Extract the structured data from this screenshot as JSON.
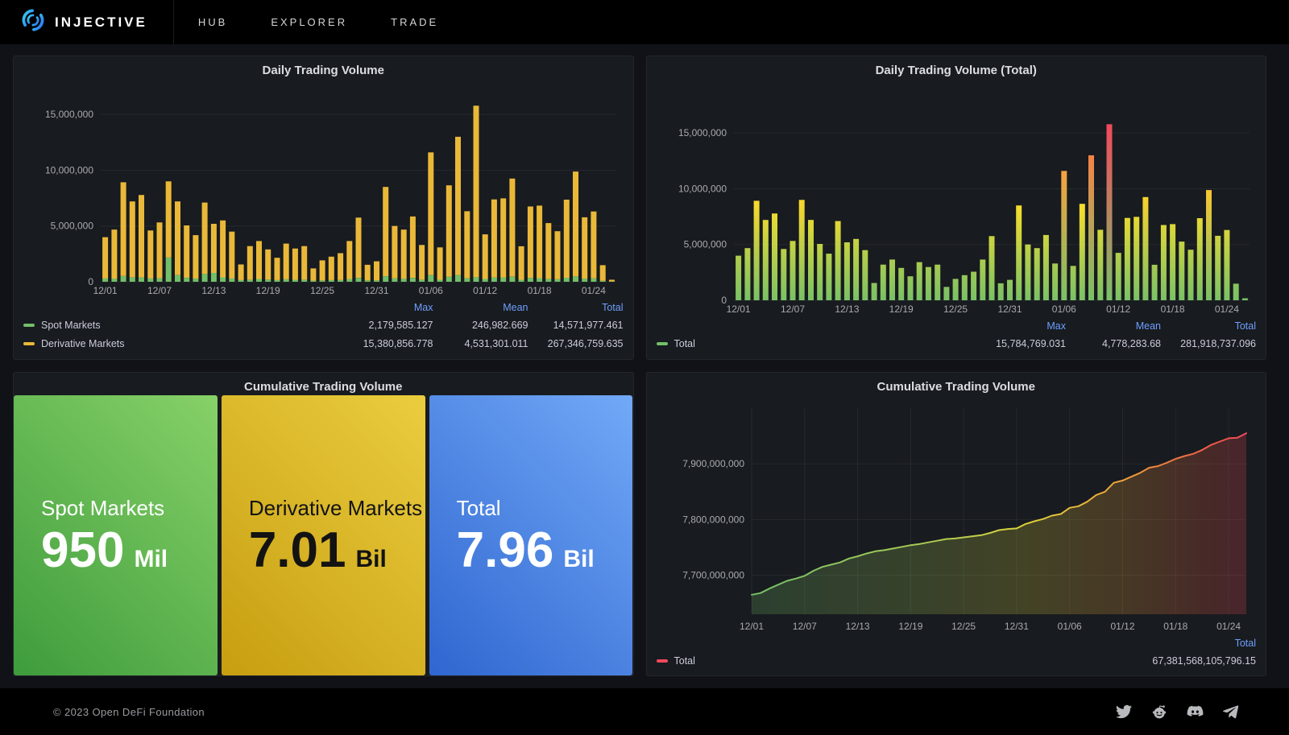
{
  "nav": {
    "brand": "INJECTIVE",
    "items": [
      {
        "label": "HUB"
      },
      {
        "label": "EXPLORER"
      },
      {
        "label": "TRADE"
      }
    ]
  },
  "footer": {
    "copyright": "© 2023 Open DeFi Foundation",
    "icons": [
      "twitter-icon",
      "reddit-icon",
      "discord-icon",
      "telegram-icon"
    ]
  },
  "colors": {
    "spot_green": "#73BF69",
    "derivative_yellow": "#EAB839",
    "total_red": "#F2495C",
    "legend_header_blue": "#6E9FFF",
    "panel_bg": "#181b1f",
    "page_bg": "#111217"
  },
  "chart_data": [
    {
      "type": "bar",
      "stacked": true,
      "title": "Daily Trading Volume",
      "tick_every": 6,
      "yticks": [
        0,
        5000000,
        10000000,
        15000000
      ],
      "ylim": [
        0,
        16600000
      ],
      "categories": [
        "12/01",
        "12/02",
        "12/03",
        "12/04",
        "12/05",
        "12/06",
        "12/07",
        "12/08",
        "12/09",
        "12/10",
        "12/11",
        "12/12",
        "12/13",
        "12/14",
        "12/15",
        "12/16",
        "12/17",
        "12/18",
        "12/19",
        "12/20",
        "12/21",
        "12/22",
        "12/23",
        "12/24",
        "12/25",
        "12/26",
        "12/27",
        "12/28",
        "12/29",
        "12/30",
        "12/31",
        "01/01",
        "01/02",
        "01/03",
        "01/04",
        "01/05",
        "01/06",
        "01/07",
        "01/08",
        "01/09",
        "01/10",
        "01/11",
        "01/12",
        "01/13",
        "01/14",
        "01/15",
        "01/16",
        "01/17",
        "01/18",
        "01/19",
        "01/20",
        "01/21",
        "01/22",
        "01/23",
        "01/24",
        "01/25",
        "01/26"
      ],
      "series": [
        {
          "name": "Spot Markets",
          "color": "#73BF69",
          "values": [
            300000,
            280000,
            520000,
            400000,
            380000,
            300000,
            320000,
            2179585,
            600000,
            350000,
            280000,
            700000,
            800000,
            400000,
            300000,
            150000,
            200000,
            250000,
            200000,
            150000,
            220000,
            180000,
            200000,
            100000,
            120000,
            150000,
            160000,
            250000,
            350000,
            120000,
            130000,
            500000,
            300000,
            280000,
            350000,
            200000,
            600000,
            180000,
            450000,
            600000,
            320000,
            403912,
            250000,
            380000,
            380000,
            450000,
            180000,
            350000,
            330000,
            260000,
            230000,
            360000,
            480000,
            280000,
            300000,
            90000,
            30000
          ]
        },
        {
          "name": "Derivative Markets",
          "color": "#EAB839",
          "values": [
            3700000,
            4400000,
            8400000,
            6800000,
            7400000,
            4300000,
            5000000,
            6820000,
            6600000,
            4700000,
            3900000,
            6400000,
            4400000,
            5100000,
            4200000,
            1400000,
            3000000,
            3400000,
            2700000,
            2000000,
            3200000,
            2800000,
            3000000,
            1100000,
            1800000,
            2100000,
            2400000,
            3400000,
            5400000,
            1400000,
            1700000,
            8000000,
            4700000,
            4400000,
            5500000,
            3100000,
            11000000,
            2900000,
            8200000,
            12400000,
            6000000,
            15380857,
            4000000,
            7000000,
            7100000,
            8800000,
            3000000,
            6400000,
            6500000,
            5000000,
            4300000,
            7000000,
            9400000,
            5500000,
            6000000,
            1400000,
            150000
          ]
        }
      ],
      "legend": {
        "columns": [
          "Max",
          "Mean",
          "Total"
        ],
        "rows": [
          {
            "label": "Spot Markets",
            "color": "#73BF69",
            "values": [
              "2,179,585.127",
              "246,982.669",
              "14,571,977.461"
            ]
          },
          {
            "label": "Derivative Markets",
            "color": "#EAB839",
            "values": [
              "15,380,856.778",
              "4,531,301.011",
              "267,346,759.635"
            ]
          }
        ]
      }
    },
    {
      "type": "bar",
      "stacked": false,
      "color_mode": "scheme-green-yellow-red",
      "title": "Daily Trading Volume (Total)",
      "tick_every": 6,
      "yticks": [
        0,
        5000000,
        10000000,
        15000000
      ],
      "ylim": [
        0,
        16600000
      ],
      "categories": [
        "12/01",
        "12/02",
        "12/03",
        "12/04",
        "12/05",
        "12/06",
        "12/07",
        "12/08",
        "12/09",
        "12/10",
        "12/11",
        "12/12",
        "12/13",
        "12/14",
        "12/15",
        "12/16",
        "12/17",
        "12/18",
        "12/19",
        "12/20",
        "12/21",
        "12/22",
        "12/23",
        "12/24",
        "12/25",
        "12/26",
        "12/27",
        "12/28",
        "12/29",
        "12/30",
        "12/31",
        "01/01",
        "01/02",
        "01/03",
        "01/04",
        "01/05",
        "01/06",
        "01/07",
        "01/08",
        "01/09",
        "01/10",
        "01/11",
        "01/12",
        "01/13",
        "01/14",
        "01/15",
        "01/16",
        "01/17",
        "01/18",
        "01/19",
        "01/20",
        "01/21",
        "01/22",
        "01/23",
        "01/24",
        "01/25",
        "01/26"
      ],
      "series": [
        {
          "name": "Total",
          "values": [
            4000000,
            4680000,
            8920000,
            7200000,
            7780000,
            4600000,
            5320000,
            8999585,
            7200000,
            5050000,
            4180000,
            7100000,
            5200000,
            5500000,
            4500000,
            1550000,
            3200000,
            3650000,
            2900000,
            2150000,
            3420000,
            2980000,
            3200000,
            1200000,
            1920000,
            2250000,
            2560000,
            3650000,
            5750000,
            1520000,
            1830000,
            8500000,
            5000000,
            4680000,
            5850000,
            3300000,
            11600000,
            3080000,
            8650000,
            13000000,
            6320000,
            15784769,
            4250000,
            7380000,
            7480000,
            9250000,
            3180000,
            6750000,
            6830000,
            5260000,
            4530000,
            7360000,
            9880000,
            5780000,
            6300000,
            1490000,
            180000
          ]
        }
      ],
      "legend": {
        "columns": [
          "Max",
          "Mean",
          "Total"
        ],
        "rows": [
          {
            "label": "Total",
            "color": "#73BF69",
            "values": [
              "15,784,769.031",
              "4,778,283.68",
              "281,918,737.096"
            ]
          }
        ]
      }
    },
    {
      "type": "stat",
      "title": "Cumulative Trading Volume",
      "stats": [
        {
          "label": "Spot Markets",
          "value": "950",
          "unit": "Mil",
          "theme": "green"
        },
        {
          "label": "Derivative Markets",
          "value": "7.01",
          "unit": "Bil",
          "theme": "yellow"
        },
        {
          "label": "Total",
          "value": "7.96",
          "unit": "Bil",
          "theme": "blue"
        }
      ]
    },
    {
      "type": "line",
      "title": "Cumulative Trading Volume",
      "tick_every": 6,
      "yticks": [
        7700000000,
        7800000000,
        7900000000
      ],
      "ylim": [
        7630000000,
        8000000000
      ],
      "categories": [
        "12/01",
        "12/02",
        "12/03",
        "12/04",
        "12/05",
        "12/06",
        "12/07",
        "12/08",
        "12/09",
        "12/10",
        "12/11",
        "12/12",
        "12/13",
        "12/14",
        "12/15",
        "12/16",
        "12/17",
        "12/18",
        "12/19",
        "12/20",
        "12/21",
        "12/22",
        "12/23",
        "12/24",
        "12/25",
        "12/26",
        "12/27",
        "12/28",
        "12/29",
        "12/30",
        "12/31",
        "01/01",
        "01/02",
        "01/03",
        "01/04",
        "01/05",
        "01/06",
        "01/07",
        "01/08",
        "01/09",
        "01/10",
        "01/11",
        "01/12",
        "01/13",
        "01/14",
        "01/15",
        "01/16",
        "01/17",
        "01/18",
        "01/19",
        "01/20",
        "01/21",
        "01/22",
        "01/23",
        "01/24",
        "01/25",
        "01/26"
      ],
      "series": [
        {
          "name": "Total",
          "values": [
            7665000000,
            7668000000,
            7676000000,
            7683000000,
            7690000000,
            7694000000,
            7699000000,
            7708000000,
            7715000000,
            7719000000,
            7723000000,
            7730000000,
            7734000000,
            7739000000,
            7743000000,
            7745000000,
            7748000000,
            7751000000,
            7754000000,
            7756000000,
            7759000000,
            7762000000,
            7765000000,
            7766000000,
            7768000000,
            7770000000,
            7772000000,
            7776000000,
            7781000000,
            7783000000,
            7784000000,
            7792000000,
            7797000000,
            7801000000,
            7807000000,
            7810000000,
            7821000000,
            7824000000,
            7832000000,
            7844000000,
            7850000000,
            7866000000,
            7870000000,
            7877000000,
            7884000000,
            7893000000,
            7896000000,
            7902000000,
            7909000000,
            7914000000,
            7918000000,
            7925000000,
            7934000000,
            7940000000,
            7946000000,
            7947000000,
            7955000000
          ]
        }
      ],
      "legend": {
        "columns": [
          "Total"
        ],
        "rows": [
          {
            "label": "Total",
            "color": "#F2495C",
            "values": [
              "67,381,568,105,796.15"
            ]
          }
        ]
      }
    }
  ]
}
